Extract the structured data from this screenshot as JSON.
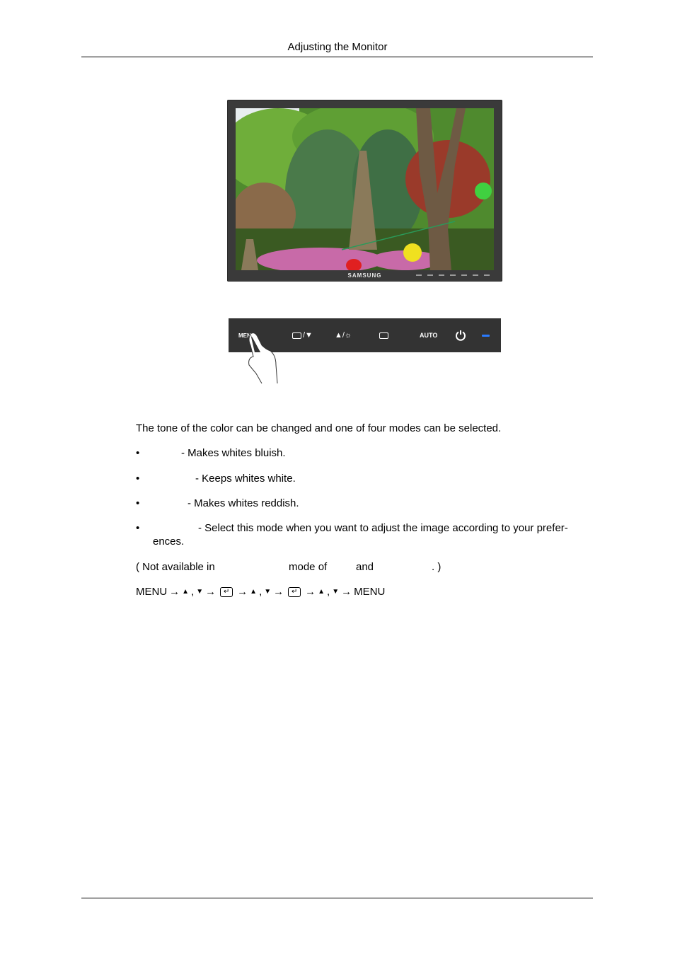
{
  "header": {
    "title": "Adjusting the Monitor"
  },
  "monitor_image": {
    "brand": "SAMSUNG",
    "scene": "garden-with-pagoda-and-lanterns"
  },
  "control_panel": {
    "menu_label": "MENU",
    "down_label": "/▼",
    "up_label": "▲/☼",
    "auto_label": "AUTO",
    "led_color": "#2a7bff"
  },
  "body": {
    "intro": "The tone of the color can be changed and one of four modes can be selected.",
    "bullets": [
      {
        "text": "- Makes whites bluish."
      },
      {
        "text": "- Keeps whites white."
      },
      {
        "text": "- Makes whites reddish."
      },
      {
        "text": "- Select this mode when you want to adjust the image according to your prefer-",
        "continuation": "ences."
      }
    ],
    "bullet_glyph": "•",
    "note_parts": [
      "( Not available in",
      "mode of",
      "and",
      ". )"
    ],
    "nav": {
      "menu": "MENU",
      "arrow": "→",
      "up": "▲",
      "comma": ",",
      "down": "▼",
      "enter": "↵"
    }
  }
}
